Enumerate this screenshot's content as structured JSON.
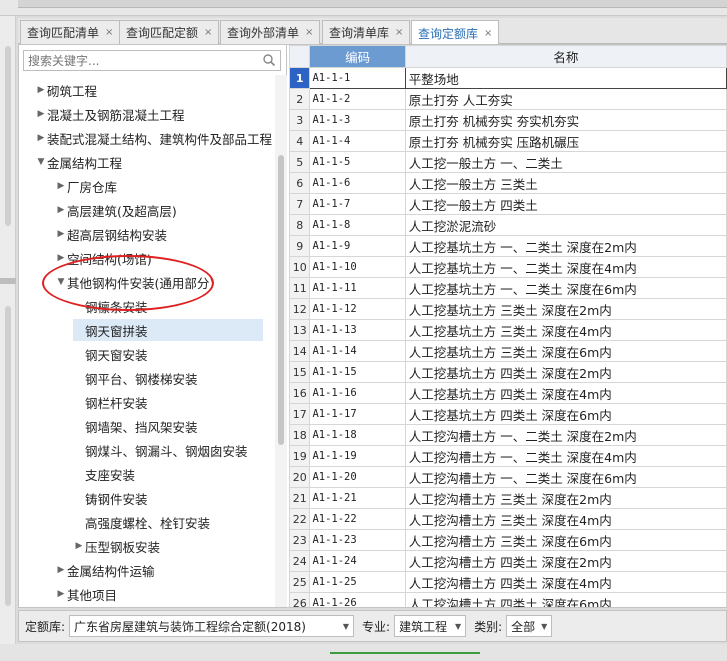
{
  "tabs": [
    {
      "label": "查询匹配清单",
      "close": "×"
    },
    {
      "label": "查询匹配定额",
      "close": "×"
    },
    {
      "label": "查询外部清单",
      "close": "×"
    },
    {
      "label": "查询清单库",
      "close": "×"
    },
    {
      "label": "查询定额库",
      "close": "×"
    }
  ],
  "search": {
    "placeholder": "搜索关键字..."
  },
  "tree": [
    {
      "label": "砌筑工程"
    },
    {
      "label": "混凝土及钢筋混凝土工程"
    },
    {
      "label": "装配式混凝土结构、建筑构件及部品工程"
    },
    {
      "label": "金属结构工程"
    },
    {
      "label": "厂房仓库"
    },
    {
      "label": "高层建筑(及超高层)"
    },
    {
      "label": "超高层钢结构安装"
    },
    {
      "label": "空间结构(场馆)"
    },
    {
      "label": "其他钢构件安装(通用部分)"
    },
    {
      "label": "钢檩条安装"
    },
    {
      "label": "钢天窗拼装"
    },
    {
      "label": "钢天窗安装"
    },
    {
      "label": "钢平台、钢楼梯安装"
    },
    {
      "label": "钢栏杆安装"
    },
    {
      "label": "钢墙架、挡风架安装"
    },
    {
      "label": "钢煤斗、钢漏斗、钢烟囱安装"
    },
    {
      "label": "支座安装"
    },
    {
      "label": "铸钢件安装"
    },
    {
      "label": "高强度螺栓、栓钉安装"
    },
    {
      "label": "压型钢板安装"
    },
    {
      "label": "金属结构件运输"
    },
    {
      "label": "其他项目"
    }
  ],
  "grid": {
    "col_code": "编码",
    "col_name": "名称",
    "rows": [
      {
        "n": "1",
        "code": "A1-1-1",
        "name": "平整场地"
      },
      {
        "n": "2",
        "code": "A1-1-2",
        "name": "原土打夯 人工夯实"
      },
      {
        "n": "3",
        "code": "A1-1-3",
        "name": "原土打夯 机械夯实 夯实机夯实"
      },
      {
        "n": "4",
        "code": "A1-1-4",
        "name": "原土打夯 机械夯实 压路机碾压"
      },
      {
        "n": "5",
        "code": "A1-1-5",
        "name": "人工挖一般土方 一、二类土"
      },
      {
        "n": "6",
        "code": "A1-1-6",
        "name": "人工挖一般土方 三类土"
      },
      {
        "n": "7",
        "code": "A1-1-7",
        "name": "人工挖一般土方 四类土"
      },
      {
        "n": "8",
        "code": "A1-1-8",
        "name": "人工挖淤泥流砂"
      },
      {
        "n": "9",
        "code": "A1-1-9",
        "name": "人工挖基坑土方 一、二类土 深度在2m内"
      },
      {
        "n": "10",
        "code": "A1-1-10",
        "name": "人工挖基坑土方 一、二类土 深度在4m内"
      },
      {
        "n": "11",
        "code": "A1-1-11",
        "name": "人工挖基坑土方 一、二类土 深度在6m内"
      },
      {
        "n": "12",
        "code": "A1-1-12",
        "name": "人工挖基坑土方 三类土 深度在2m内"
      },
      {
        "n": "13",
        "code": "A1-1-13",
        "name": "人工挖基坑土方 三类土 深度在4m内"
      },
      {
        "n": "14",
        "code": "A1-1-14",
        "name": "人工挖基坑土方 三类土 深度在6m内"
      },
      {
        "n": "15",
        "code": "A1-1-15",
        "name": "人工挖基坑土方 四类土 深度在2m内"
      },
      {
        "n": "16",
        "code": "A1-1-16",
        "name": "人工挖基坑土方 四类土 深度在4m内"
      },
      {
        "n": "17",
        "code": "A1-1-17",
        "name": "人工挖基坑土方 四类土 深度在6m内"
      },
      {
        "n": "18",
        "code": "A1-1-18",
        "name": "人工挖沟槽土方 一、二类土 深度在2m内"
      },
      {
        "n": "19",
        "code": "A1-1-19",
        "name": "人工挖沟槽土方 一、二类土 深度在4m内"
      },
      {
        "n": "20",
        "code": "A1-1-20",
        "name": "人工挖沟槽土方 一、二类土 深度在6m内"
      },
      {
        "n": "21",
        "code": "A1-1-21",
        "name": "人工挖沟槽土方 三类土 深度在2m内"
      },
      {
        "n": "22",
        "code": "A1-1-22",
        "name": "人工挖沟槽土方 三类土 深度在4m内"
      },
      {
        "n": "23",
        "code": "A1-1-23",
        "name": "人工挖沟槽土方 三类土 深度在6m内"
      },
      {
        "n": "24",
        "code": "A1-1-24",
        "name": "人工挖沟槽土方 四类土 深度在2m内"
      },
      {
        "n": "25",
        "code": "A1-1-25",
        "name": "人工挖沟槽土方 四类土 深度在4m内"
      },
      {
        "n": "26",
        "code": "A1-1-26",
        "name": "人工挖沟槽土方 四类土 深度在6m内"
      }
    ]
  },
  "bottom": {
    "lib_label": "定额库:",
    "lib_value": "广东省房屋建筑与装饰工程综合定额(2018)",
    "spec_label": "专业:",
    "spec_value": "建筑工程",
    "cat_label": "类别:",
    "cat_value": "全部"
  },
  "colors": {
    "accent": "#2e63c6",
    "header": "#6b9bd1",
    "annotation": "#e02020"
  }
}
